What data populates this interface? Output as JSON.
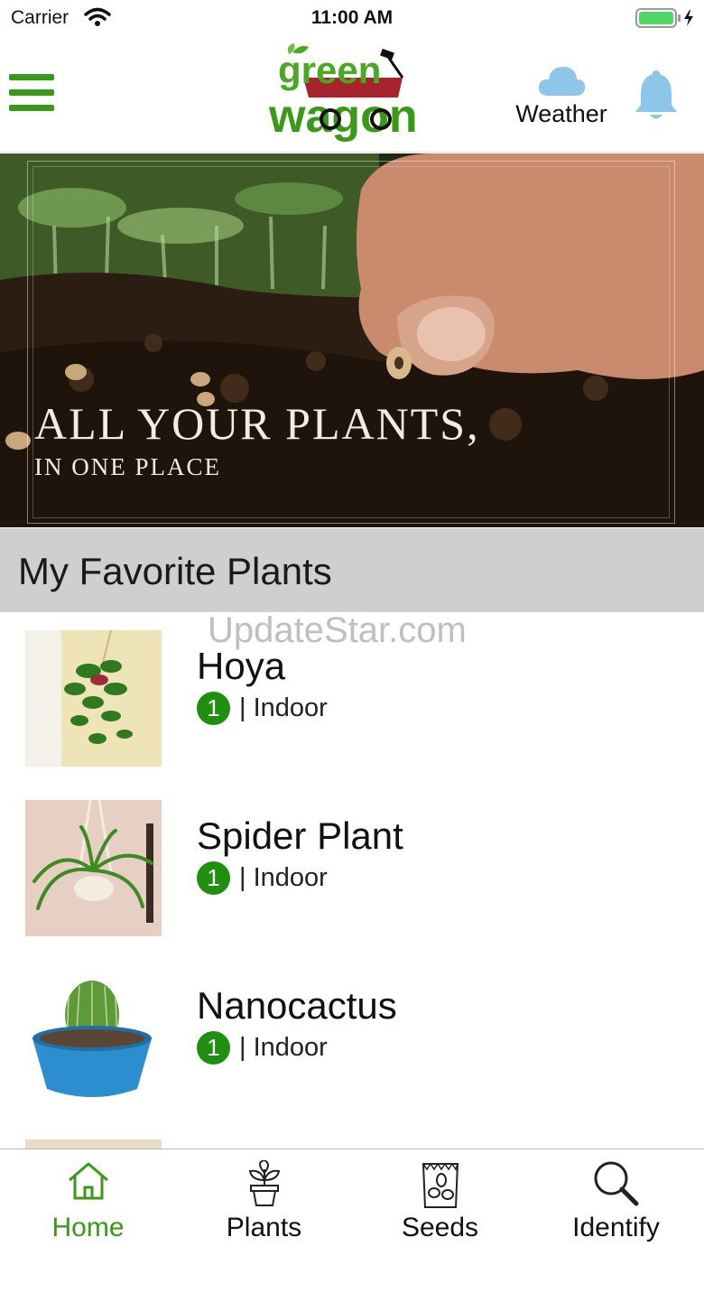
{
  "status_bar": {
    "carrier": "Carrier",
    "time": "11:00 AM"
  },
  "header": {
    "logo_top": "green",
    "logo_bottom": "wagon",
    "weather_label": "Weather"
  },
  "banner": {
    "title": "ALL YOUR PLANTS,",
    "subtitle": "IN ONE PLACE"
  },
  "section": {
    "title": "My Favorite Plants"
  },
  "watermark": "UpdateStar.com",
  "plants": [
    {
      "name": "Hoya",
      "count": "1",
      "category": "| Indoor"
    },
    {
      "name": "Spider Plant",
      "count": "1",
      "category": "| Indoor"
    },
    {
      "name": "Nanocactus",
      "count": "1",
      "category": "| Indoor"
    }
  ],
  "tabs": [
    {
      "label": "Home",
      "icon": "home-icon",
      "active": true
    },
    {
      "label": "Plants",
      "icon": "potted-plant-icon",
      "active": false
    },
    {
      "label": "Seeds",
      "icon": "seed-bag-icon",
      "active": false
    },
    {
      "label": "Identify",
      "icon": "magnifier-icon",
      "active": false
    }
  ],
  "colors": {
    "brand_green": "#3a9a17",
    "badge_green": "#1f8f10",
    "weather_blue": "#8cc7ea"
  }
}
